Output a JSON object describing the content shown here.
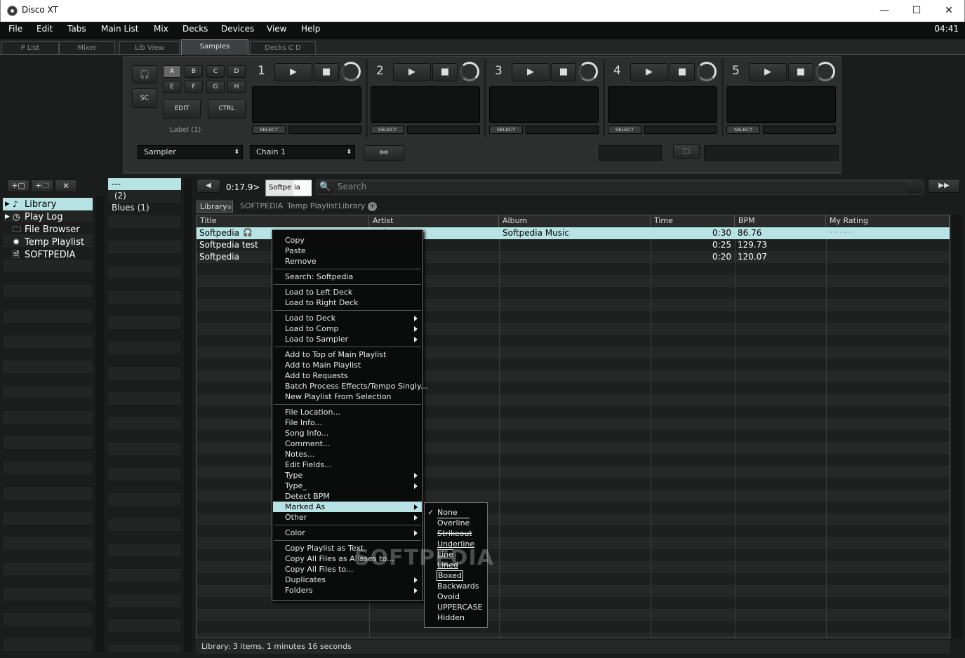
{
  "window": {
    "title": "Disco XT"
  },
  "menubar": {
    "items": [
      "File",
      "Edit",
      "Tabs",
      "Main List",
      "Mix",
      "Decks",
      "Devices",
      "View",
      "Help"
    ],
    "clock": "04:41"
  },
  "top_tabs": {
    "items": [
      "P List",
      "Mixer",
      "Lib View",
      "Samples",
      "Decks C D"
    ],
    "active": "Samples"
  },
  "sampler": {
    "bank_letters": [
      "A",
      "B",
      "C",
      "D",
      "E",
      "F",
      "G",
      "H"
    ],
    "sc_label": "SC",
    "edit_label": "EDIT",
    "ctrl_label": "CTRL",
    "bank_label": "Label (1)",
    "slots": [
      "1",
      "2",
      "3",
      "4",
      "5"
    ],
    "select_label": "SELECT",
    "sampler_combo": "Sampler",
    "chain_combo": "Chain 1"
  },
  "sidebar": {
    "items": [
      {
        "label": "Library",
        "icon": "note-icon",
        "selected": true
      },
      {
        "label": "Play Log",
        "icon": "clock-icon",
        "selected": false
      },
      {
        "label": "File Browser",
        "icon": "folder-icon",
        "selected": false
      },
      {
        "label": "Temp Playlist",
        "icon": "asterisk-icon",
        "selected": false
      },
      {
        "label": "SOFTPEDIA",
        "icon": "playlist-file-icon",
        "selected": false
      }
    ]
  },
  "genre_list": {
    "items": [
      "---",
      " (2)",
      "Blues (1)"
    ]
  },
  "transport": {
    "time": "0:17.9>",
    "search_chip": "Softpe",
    "search_chip_tail": "ia",
    "search_placeholder": "Search"
  },
  "list_tabs": [
    "Library",
    "SOFTPEDIA",
    "Temp Playlist",
    "Library"
  ],
  "columns": [
    "Title",
    "Artist",
    "Album",
    "Time",
    "BPM",
    "My Rating"
  ],
  "rows": [
    {
      "title": "Softpedia",
      "artist": "Softpedia",
      "album": "Softpedia Music",
      "time": "0:30",
      "bpm": "86.76",
      "rating": "- - - - -",
      "selected": true
    },
    {
      "title": "Softpedia test",
      "artist": "",
      "album": "",
      "time": "0:25",
      "bpm": "129.73",
      "rating": "",
      "selected": false
    },
    {
      "title": "Softpedia",
      "artist": "",
      "album": "",
      "time": "0:20",
      "bpm": "120.07",
      "rating": "",
      "selected": false
    }
  ],
  "status": "Library: 3 items, 1 minutes 16 seconds",
  "context_menu": {
    "groups": [
      [
        "Copy",
        "Paste",
        "Remove"
      ],
      [
        "Search: Softpedia"
      ],
      [
        "Load to Left Deck",
        "Load to Right Deck"
      ],
      [
        "Load to Deck",
        "Load to Comp",
        "Load to Sampler"
      ],
      [
        "Add to Top of Main Playlist",
        "Add to Main Playlist",
        "Add to Requests",
        "Batch Process Effects/Tempo Singly...",
        "New Playlist From Selection"
      ],
      [
        "File Location...",
        "File Info...",
        "Song Info...",
        "Comment...",
        "Notes...",
        "Edit Fields...",
        "Type",
        "Type_",
        "Detect BPM",
        "Marked As",
        "Other"
      ],
      [
        "Color"
      ],
      [
        "Copy Playlist as Text",
        "Copy All Files as Aliases to...",
        "Copy All Files to...",
        "Duplicates",
        "Folders"
      ]
    ],
    "submenu_items": [
      "Load to Deck",
      "Load to Comp",
      "Load to Sampler",
      "Type",
      "Type_",
      "Marked As",
      "Other",
      "Color",
      "Duplicates",
      "Folders"
    ],
    "highlighted": "Marked As"
  },
  "marked_as_submenu": {
    "items": [
      "None",
      "Overline",
      "Strikeout",
      "Underline",
      "Line",
      "Lined",
      "Boxed",
      "Backwards",
      "Ovoid",
      "UPPERCASE",
      "Hidden"
    ],
    "checked": "None"
  },
  "watermark": "SOFTPEDIA"
}
